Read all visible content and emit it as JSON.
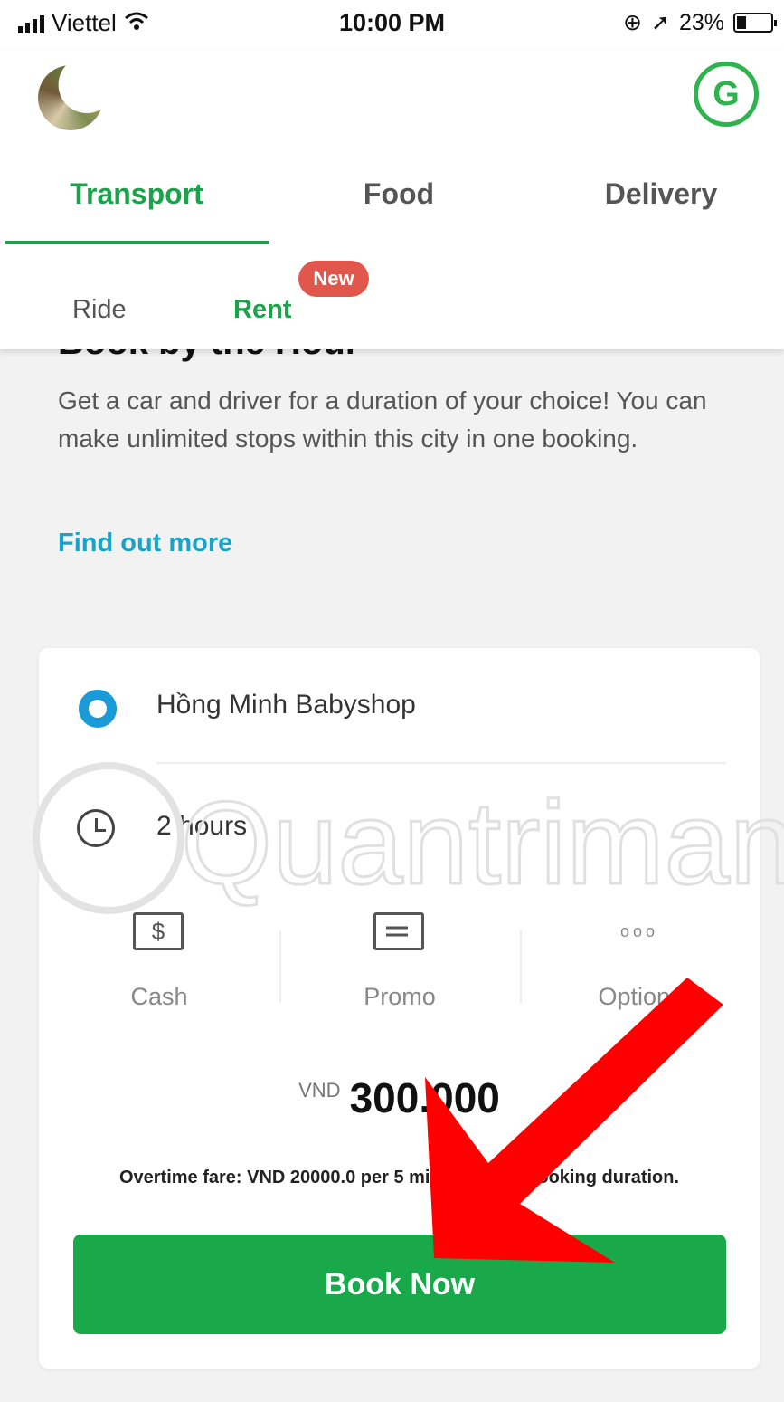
{
  "status_bar": {
    "carrier": "Viettel",
    "time": "10:00 PM",
    "battery": "23%"
  },
  "header": {
    "profile_initial": "G"
  },
  "tabs": [
    {
      "label": "Transport",
      "active": true
    },
    {
      "label": "Food",
      "active": false
    },
    {
      "label": "Delivery",
      "active": false
    }
  ],
  "subtabs": [
    {
      "label": "Ride",
      "active": false
    },
    {
      "label": "Rent",
      "active": true
    }
  ],
  "new_badge": "New",
  "intro": {
    "title": "Book by the Hour",
    "description": "Get a car and driver for a duration of your choice! You can make unlimited stops within this city in one booking.",
    "link": "Find out more"
  },
  "booking": {
    "location": "Hồng Minh Babyshop",
    "duration": "2 hours",
    "payment": [
      {
        "label": "Cash",
        "icon": "cash-icon",
        "glyph": "$"
      },
      {
        "label": "Promo",
        "icon": "promo-icon",
        "glyph": ""
      },
      {
        "label": "Options",
        "icon": "more-icon",
        "glyph": "ooo"
      }
    ],
    "currency": "VND",
    "amount": "300.000",
    "overtime_note": "Overtime fare: VND 20000.0 per 5 minutes over booking duration.",
    "button_label": "Book Now"
  },
  "watermark": "Quantrimang",
  "colors": {
    "brand_green": "#1aa34a",
    "link_blue": "#1aa3c4",
    "badge_red": "#e2574c",
    "arrow_red": "#ff0000"
  }
}
